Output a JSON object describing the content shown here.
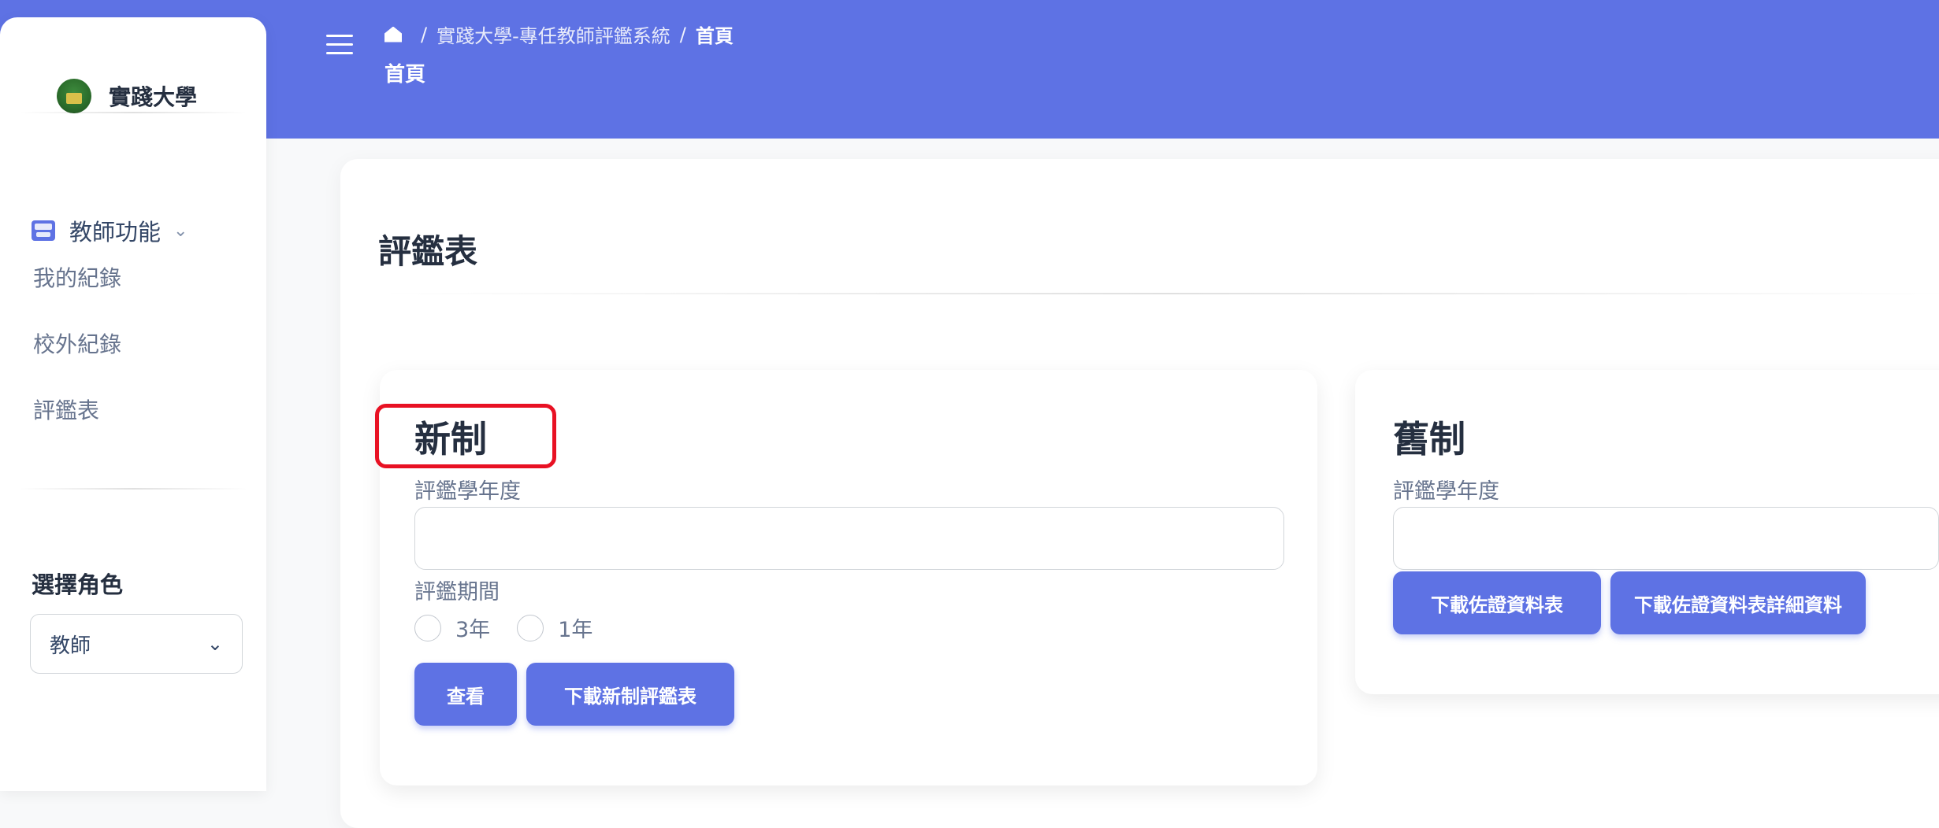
{
  "brand": {
    "name": "實踐大學",
    "logo_icon": "university-logo-icon"
  },
  "sidebar": {
    "group_label": "教師功能",
    "group_icon": "chalkboard-teacher-icon",
    "items": [
      {
        "label": "我的紀錄"
      },
      {
        "label": "校外紀錄"
      },
      {
        "label": "評鑑表"
      }
    ],
    "role_heading": "選擇角色",
    "role_selected": "教師"
  },
  "header": {
    "breadcrumb": {
      "sep": "/",
      "system": "實踐大學-專任教師評鑑系統",
      "current": "首頁"
    },
    "title": "首頁"
  },
  "main": {
    "title": "評鑑表",
    "new_card": {
      "title": "新制",
      "year_label": "評鑑學年度",
      "year_value": "",
      "period_label": "評鑑期間",
      "period_options": [
        "3年",
        "1年"
      ],
      "view_button": "查看",
      "download_button": "下載新制評鑑表"
    },
    "old_card": {
      "title": "舊制",
      "year_label": "評鑑學年度",
      "year_value": "",
      "download_evidence_button": "下載佐證資料表",
      "download_evidence_detail_button": "下載佐證資料表詳細資料"
    }
  },
  "colors": {
    "primary": "#5e72e4",
    "highlight": "#e81123"
  }
}
